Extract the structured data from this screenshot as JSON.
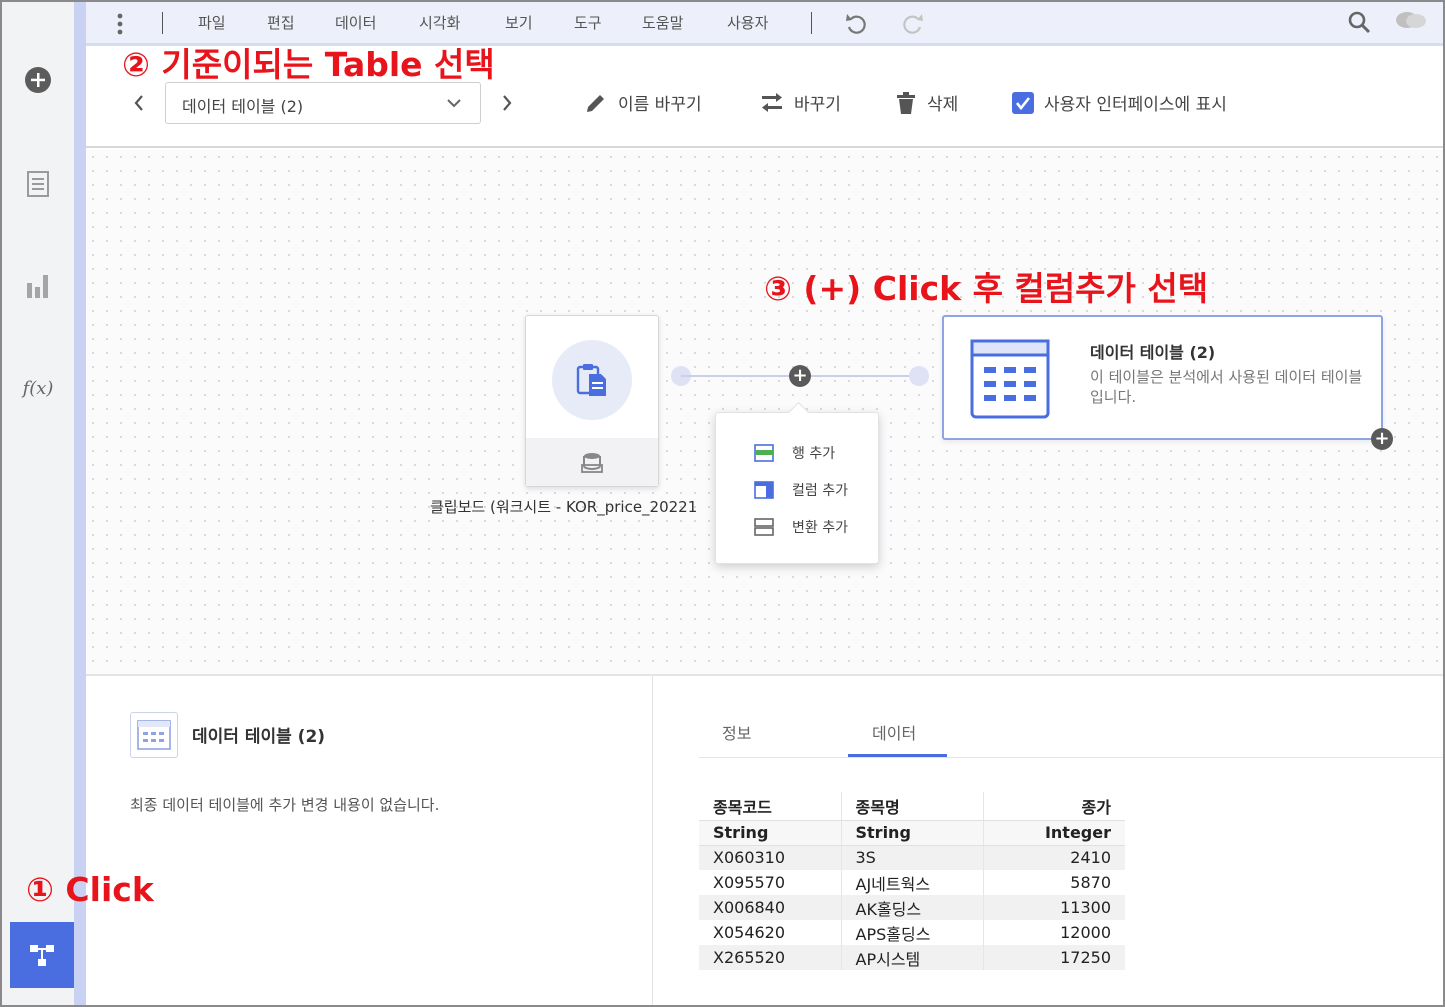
{
  "menu": {
    "items": [
      "파일",
      "편집",
      "데이터",
      "시각화",
      "보기",
      "도구",
      "도움말",
      "사용자"
    ]
  },
  "sidebar": {
    "fx_label": "f(x)"
  },
  "toolbar": {
    "table_select": "데이터 테이블 (2)",
    "rename": "이름 바꾸기",
    "replace": "바꾸기",
    "delete": "삭제",
    "show_in_ui": "사용자 인터페이스에 표시",
    "show_in_ui_checked": true
  },
  "canvas": {
    "source_caption": "클립보드 (워크시트 - KOR_price_20221",
    "target_title": "데이터 테이블 (2)",
    "target_desc": "이 테이블은 분석에서 사용된 데이터 테이블입니다.",
    "popup": {
      "add_row": "행 추가",
      "add_column": "컬럼 추가",
      "add_transform": "변환 추가"
    }
  },
  "bottom": {
    "title": "데이터 테이블 (2)",
    "message": "최종 데이터 테이블에 추가 변경 내용이 없습니다.",
    "tabs": [
      "정보",
      "데이터"
    ],
    "active_tab": "데이터",
    "table": {
      "headers": [
        "종목코드",
        "종목명",
        "종가"
      ],
      "types": [
        "String",
        "String",
        "Integer"
      ],
      "rows": [
        [
          "X060310",
          "3S",
          "2410"
        ],
        [
          "X095570",
          "AJ네트웍스",
          "5870"
        ],
        [
          "X006840",
          "AK홀딩스",
          "11300"
        ],
        [
          "X054620",
          "APS홀딩스",
          "12000"
        ],
        [
          "X265520",
          "AP시스템",
          "17250"
        ]
      ]
    }
  },
  "annotations": {
    "step1": "① Click",
    "step2": "② 기준이되는 Table 선택",
    "step3": "③ (+) Click 후 컬럼추가 선택"
  },
  "colors": {
    "accent": "#4a6ee0",
    "annotation": "#e8141b",
    "sidebar_edge": "#c9d2f2"
  }
}
